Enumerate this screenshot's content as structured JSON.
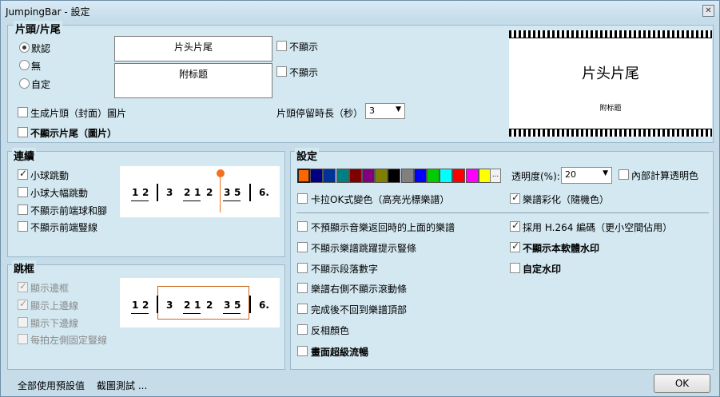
{
  "window": {
    "title": "JumpingBar - 設定",
    "close": "✕"
  },
  "header_section": {
    "title": "片頭/片尾",
    "radios": [
      {
        "label": "默認",
        "checked": true
      },
      {
        "label": "無",
        "checked": false
      },
      {
        "label": "自定",
        "checked": false
      }
    ],
    "title_field": "片头片尾",
    "subtitle_field": "附标题",
    "hide1": {
      "label": "不顯示",
      "checked": false
    },
    "hide2": {
      "label": "不顯示",
      "checked": false
    },
    "gen_cover": {
      "label": "生成片頭（封面）圖片",
      "checked": false
    },
    "hide_tail": {
      "label": "不顯示片尾（圖片）",
      "checked": false
    },
    "stay_label": "片頭停留時長（秒）",
    "stay_value": "3",
    "preview_title": "片头片尾",
    "preview_subtitle": "附标题"
  },
  "continuous": {
    "title": "連續",
    "options": [
      {
        "label": "小球跳動",
        "checked": true
      },
      {
        "label": "小球大幅跳動",
        "checked": false
      },
      {
        "label": "不顯示前端球和腳",
        "checked": false
      },
      {
        "label": "不顯示前端豎線",
        "checked": false
      }
    ],
    "notes": [
      "1",
      "2",
      "3",
      "2",
      "1",
      "2",
      "3",
      "5",
      "6."
    ]
  },
  "jumpframe": {
    "title": "跳框",
    "options": [
      {
        "label": "顯示邊框",
        "checked": true
      },
      {
        "label": "顯示上邊線",
        "checked": true
      },
      {
        "label": "顯示下邊線",
        "checked": false
      },
      {
        "label": "每拍左側固定豎線",
        "checked": false
      }
    ],
    "notes": [
      "1",
      "2",
      "3",
      "2",
      "1",
      "2",
      "3",
      "5",
      "6."
    ]
  },
  "settings": {
    "title": "設定",
    "colors": [
      "#ff6600",
      "#000080",
      "#003399",
      "#008080",
      "#800000",
      "#800080",
      "#808000",
      "#000000",
      "#808080",
      "#0000ff",
      "#00cc00",
      "#00ffff",
      "#ff0000",
      "#ff00ff",
      "#ffff00"
    ],
    "more_label": "...",
    "opacity_label": "透明度(%):",
    "opacity_value": "20",
    "internal_opacity": {
      "label": "內部計算透明色",
      "checked": false
    },
    "karaoke": {
      "label": "卡拉OK式變色（高亮光標樂譜）",
      "checked": false
    },
    "colorize": {
      "label": "樂譜彩化（隨機色）",
      "checked": true
    },
    "left_opts": [
      {
        "label": "不預顯示音樂返回時的上面的樂譜",
        "checked": false,
        "bold": false
      },
      {
        "label": "不顯示樂譜跳躍提示豎條",
        "checked": false,
        "bold": false
      },
      {
        "label": "不顯示段落數字",
        "checked": false,
        "bold": false
      },
      {
        "label": "樂譜右側不顯示滾動條",
        "checked": false,
        "bold": false
      },
      {
        "label": "完成後不回到樂譜頂部",
        "checked": false,
        "bold": false
      },
      {
        "label": "反相顏色",
        "checked": false,
        "bold": false
      },
      {
        "label": "畫面超級流暢",
        "checked": false,
        "bold": true
      }
    ],
    "right_opts": [
      {
        "label": "採用 H.264 編碼（更小空間佔用）",
        "checked": true,
        "bold": false
      },
      {
        "label": "不顯示本軟體水印",
        "checked": true,
        "bold": true
      },
      {
        "label": "自定水印",
        "checked": false,
        "bold": true
      }
    ]
  },
  "footer": {
    "defaults": "全部使用預設值",
    "screenshot_test": "截圖測試 ...",
    "ok": "OK"
  }
}
